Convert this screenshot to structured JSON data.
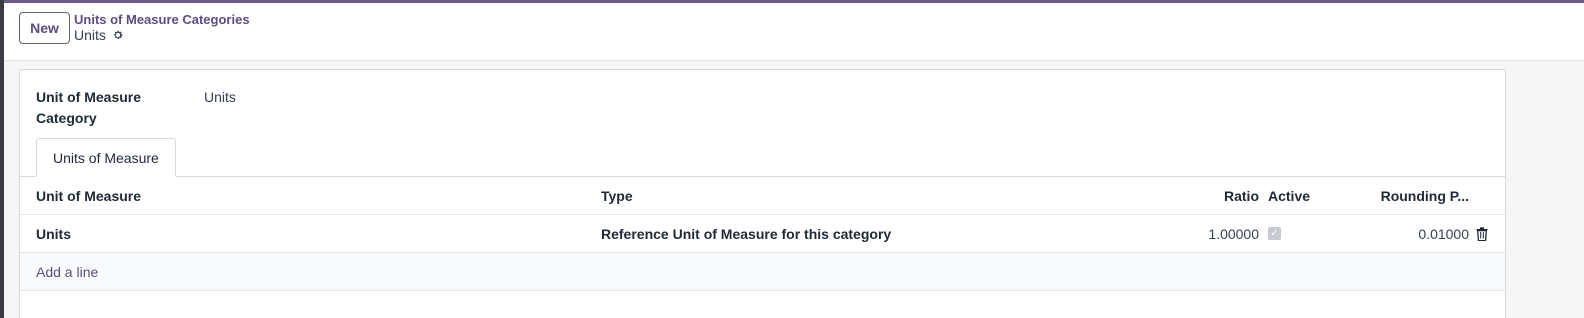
{
  "control_panel": {
    "new_button_label": "New",
    "breadcrumb": "Units of Measure Categories",
    "record_title": "Units",
    "settings_icon": "gear-icon"
  },
  "form": {
    "category_label": "Unit of Measure Category",
    "category_value": "Units"
  },
  "tabs": [
    {
      "label": "Units of Measure",
      "active": true
    }
  ],
  "table": {
    "columns": [
      "Unit of Measure",
      "Type",
      "Ratio",
      "Active",
      "Rounding P..."
    ],
    "rows": [
      {
        "unit": "Units",
        "type": "Reference Unit of Measure for this category",
        "ratio": "1.00000",
        "active": true,
        "rounding": "0.01000"
      }
    ],
    "add_line_label": "Add a line"
  },
  "colors": {
    "accent": "#6b5b8c",
    "link": "#5d4d7e"
  }
}
